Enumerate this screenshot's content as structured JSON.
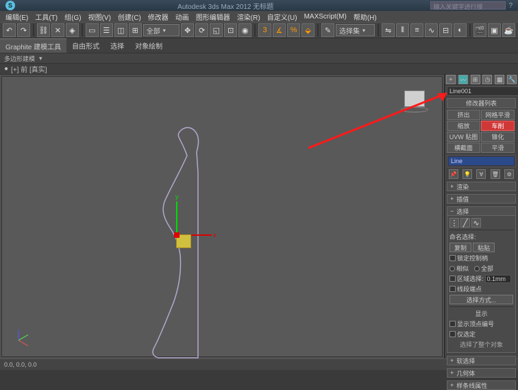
{
  "titlebar": {
    "app_title": "Autodesk 3ds Max 2012      无标题",
    "search_placeholder": "输入关键字进行搜",
    "help": "?"
  },
  "menu": {
    "items": [
      "编辑(E)",
      "工具(T)",
      "组(G)",
      "视图(V)",
      "创建(C)",
      "修改器",
      "动画",
      "图形编辑器",
      "渲染(R)",
      "自定义(U)",
      "MAXScript(M)",
      "帮助(H)"
    ]
  },
  "toolbar": {
    "dropdown1": "全部",
    "dropdown2": "选择集"
  },
  "ribbon": {
    "tabs": [
      "Graphite 建模工具",
      "自由形式",
      "选择",
      "对象绘制"
    ]
  },
  "poly_label": "多边形建模",
  "breadcrumb": "[+] 前 [真实]",
  "gizmo": {
    "x": "x",
    "y": "y"
  },
  "rcol": {
    "obj_name": "Line001",
    "modlist_label": "修改器列表",
    "mods": {
      "extrude": "挤出",
      "grid_smooth": "网格平滑",
      "bend": "缩放",
      "lathe": "车削",
      "uvw": "UVW 贴图",
      "optimize": "锥化",
      "cap": "横截面",
      "shell": "平滑"
    },
    "stack_item": "Line",
    "rollouts": {
      "render": "渲染",
      "interp": "插值",
      "select": "选择",
      "sel_body": {
        "name_sel": "命名选择:",
        "copy": "复制",
        "paste": "粘贴",
        "lock_handles": "锁定控制柄",
        "alike": "相似",
        "all": "全部",
        "area_sel": "区域选择:",
        "area_val": "0.1mm",
        "seg_end": "线段端点",
        "select_by": "选择方式...",
        "show": "显示",
        "vert_num": "显示顶点编号",
        "selected": "仅选定",
        "sel_info": "选择了整个对象"
      },
      "soft": "软选择",
      "geom": "几何体",
      "spline": "样条线属性"
    }
  },
  "status": {
    "coord": "0.0, 0.0, 0.0"
  }
}
